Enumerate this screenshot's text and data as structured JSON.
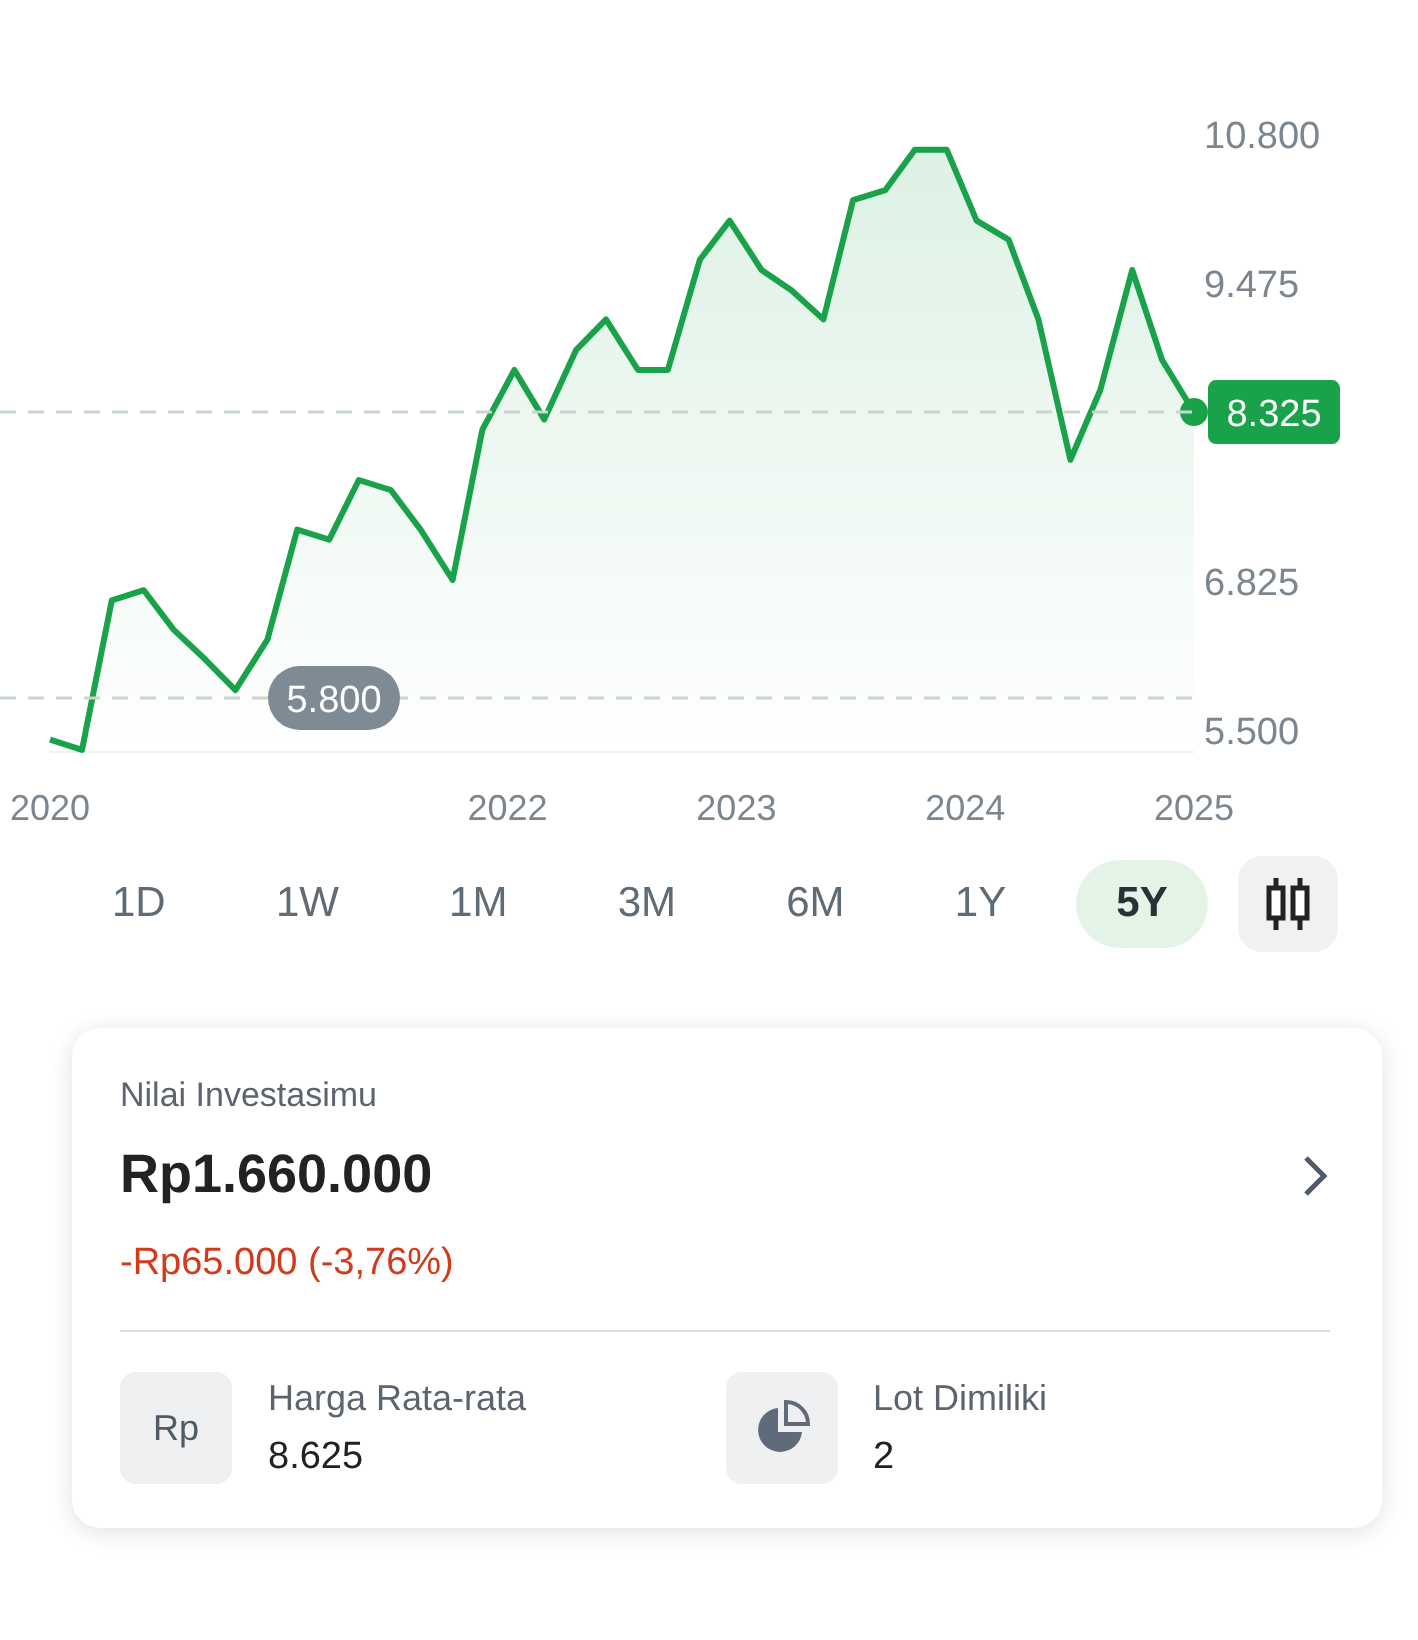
{
  "chart": {
    "chart_data": {
      "type": "area",
      "x": [
        2020,
        2020.14,
        2020.27,
        2020.41,
        2020.54,
        2020.68,
        2020.81,
        2020.95,
        2021.08,
        2021.22,
        2021.35,
        2021.49,
        2021.62,
        2021.76,
        2021.89,
        2022.03,
        2022.16,
        2022.3,
        2022.43,
        2022.57,
        2022.7,
        2022.84,
        2022.97,
        2023.11,
        2023.24,
        2023.38,
        2023.51,
        2023.65,
        2023.78,
        2023.92,
        2024.05,
        2024.19,
        2024.32,
        2024.46,
        2024.59,
        2024.73,
        2024.86,
        2025
      ],
      "series": [
        {
          "color": "#1aa24a",
          "values": [
            5410,
            5320,
            6650,
            6740,
            6390,
            6120,
            5850,
            6300,
            7280,
            7190,
            7720,
            7630,
            7280,
            6830,
            8170,
            8700,
            8260,
            8880,
            9150,
            8700,
            8700,
            9680,
            10030,
            9590,
            9410,
            9150,
            10210,
            10300,
            10660,
            10660,
            10030,
            9860,
            9150,
            7900,
            8520,
            9590,
            8790,
            8325
          ]
        }
      ],
      "xlim": [
        2020,
        2025
      ],
      "ylim": [
        5300,
        10800
      ],
      "xticks": [
        {
          "value": 2020,
          "label": "2020"
        },
        {
          "value": 2022,
          "label": "2022"
        },
        {
          "value": 2023,
          "label": "2023"
        },
        {
          "value": 2024,
          "label": "2024"
        },
        {
          "value": 2025,
          "label": "2025"
        }
      ],
      "yticks": [
        {
          "value": 5500,
          "label": "5.500"
        },
        {
          "value": 6825,
          "label": "6.825"
        },
        {
          "value": 9475,
          "label": "9.475"
        },
        {
          "value": 10800,
          "label": "10.800"
        }
      ]
    },
    "current_price": "8.325",
    "low_price": "5.800"
  },
  "periods": [
    {
      "label": "1D",
      "selected": false
    },
    {
      "label": "1W",
      "selected": false
    },
    {
      "label": "1M",
      "selected": false
    },
    {
      "label": "3M",
      "selected": false
    },
    {
      "label": "6M",
      "selected": false
    },
    {
      "label": "1Y",
      "selected": false
    },
    {
      "label": "5Y",
      "selected": true
    }
  ],
  "chart_toggle": {
    "kind": "candlestick"
  },
  "investment": {
    "title": "Nilai Investasimu",
    "value": "Rp1.660.000",
    "change": "-Rp65.000 (-3,76%)",
    "negative": true,
    "stats": [
      {
        "kind": "text",
        "icon_text": "Rp",
        "label": "Harga Rata-rata",
        "value": "8.625"
      },
      {
        "kind": "pie",
        "label": "Lot Dimiliki",
        "value": "2"
      }
    ]
  }
}
